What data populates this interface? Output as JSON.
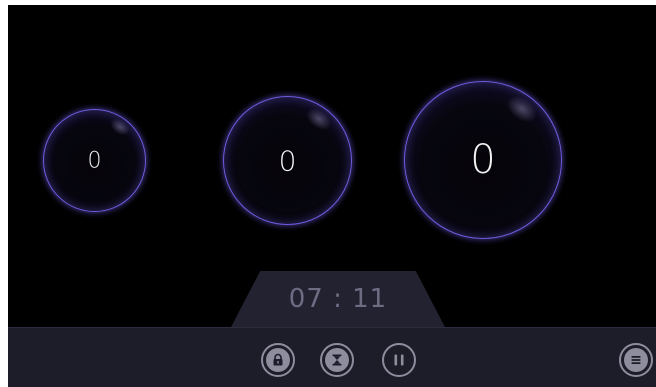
{
  "bubbles": [
    {
      "value": "0"
    },
    {
      "value": "0"
    },
    {
      "value": "0"
    }
  ],
  "timer": {
    "display": "07 : 11"
  },
  "toolbar": {
    "buttons": [
      {
        "icon": "lock-icon"
      },
      {
        "icon": "hourglass-icon"
      },
      {
        "icon": "pause-icon"
      },
      {
        "icon": "menu-icon"
      }
    ]
  },
  "colors": {
    "background": "#000000",
    "bubble_ring": "#6e5ee0",
    "toolbar": "#1d1c29",
    "timer_tab": "#232231",
    "timer_text": "#6d6c82",
    "icon": "#8d8d9e"
  }
}
